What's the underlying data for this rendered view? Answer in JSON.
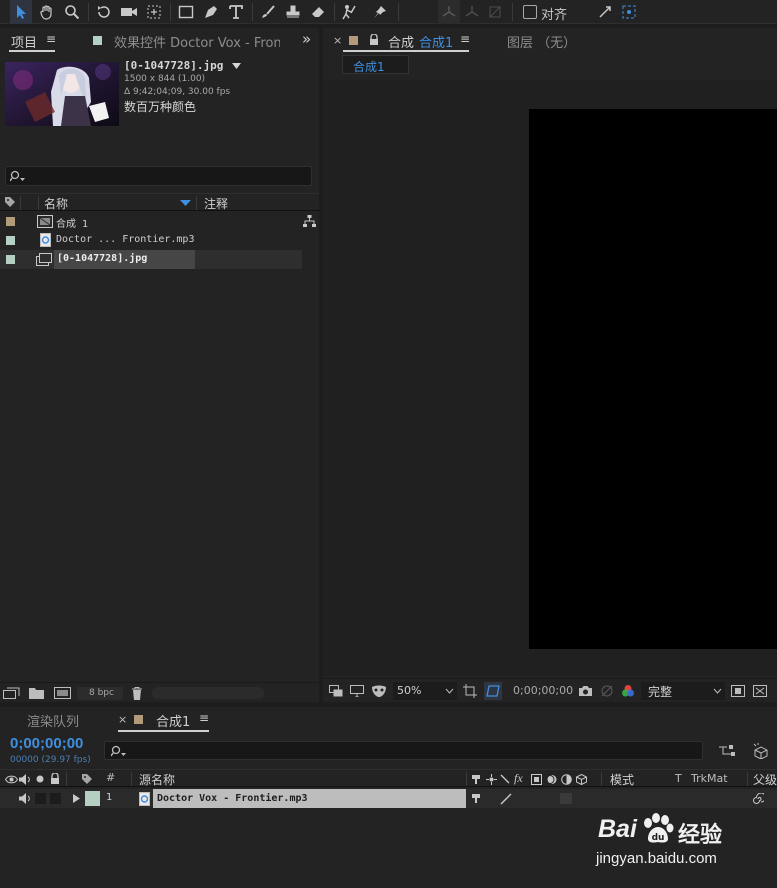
{
  "colors": {
    "accent_blue": "#3f8fe0",
    "panel_bg": "#232323",
    "app_bg": "#1d1d1d",
    "viewer_black": "#000000",
    "label_tan": "#b39a7a",
    "label_mint": "#b6cfc3",
    "selection": "#3a3a3a"
  },
  "toolbar": {
    "tools": [
      "selection-tool-icon",
      "hand-tool-icon",
      "zoom-tool-icon",
      "rotation-tool-icon",
      "camera-tool-icon",
      "pan-behind-icon",
      "rectangle-tool-icon",
      "pen-tool-icon",
      "type-tool-icon",
      "brush-tool-icon",
      "clone-stamp-icon",
      "eraser-icon",
      "roto-brush-icon",
      "puppet-pin-icon"
    ],
    "align_label": "对齐"
  },
  "project_panel": {
    "tab_project": "项目",
    "tab_effects": "效果控件 Doctor Vox - Frontier.r",
    "menu_glyph": "≡",
    "overflow_glyph": "»",
    "preview": {
      "name": "[0-1047728].jpg",
      "dimensions": "1500 x 844 (1.00)",
      "duration": "Δ 9;42;04;09, 30.00 fps",
      "colors": "数百万种颜色"
    },
    "search_placeholder": "",
    "columns": {
      "name": "名称",
      "comment": "注释"
    },
    "items": [
      {
        "name": "合成 1",
        "type": "composition",
        "label_color": "#b39a7a"
      },
      {
        "name": "Doctor ... Frontier.mp3",
        "type": "audio",
        "label_color": "#b6cfc3"
      },
      {
        "name": "[0-1047728].jpg",
        "type": "footage",
        "label_color": "#b6cfc3",
        "selected": true
      }
    ],
    "footer": {
      "bpc": "8 bpc"
    }
  },
  "comp_panel": {
    "tab_prefix": "合成",
    "tab_name": "合成1",
    "layer_tab": "图层 （无）",
    "breadcrumb": "合成1",
    "zoom": "50%",
    "timecode": "0;00;00;00",
    "resolution": "完整"
  },
  "timeline": {
    "tab_render": "渲染队列",
    "tab_comp": "合成1",
    "timecode": "0;00;00;00",
    "frame_info": "00000 (29.97 fps)",
    "headers": {
      "number": "#",
      "source_name": "源名称",
      "mode": "模式",
      "t": "T",
      "trkmat": "TrkMat",
      "parent": "父级"
    },
    "layers": [
      {
        "number": "1",
        "name": "Doctor Vox - Frontier.mp3",
        "label_color": "#b6cfc3"
      }
    ]
  },
  "watermark": {
    "brand": "Bai",
    "brand_suffix": "du",
    "product": "经验",
    "url": "jingyan.baidu.com"
  }
}
